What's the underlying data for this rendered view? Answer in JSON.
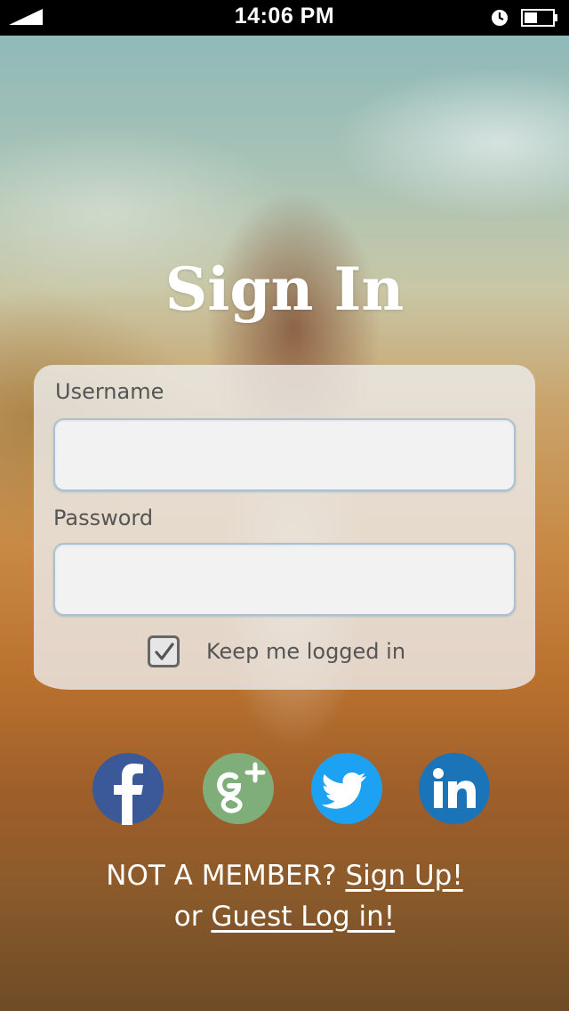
{
  "status_bar": {
    "time": "14:06 PM",
    "signal_icon": "signal-icon",
    "clock_icon": "clock-icon",
    "battery_icon": "battery-icon"
  },
  "title": "Sign In",
  "form": {
    "username_label": "Username",
    "username_value": "",
    "password_label": "Password",
    "password_value": "",
    "keep_logged_in_label": "Keep me logged in",
    "keep_logged_in_checked": true
  },
  "social": [
    {
      "name": "facebook",
      "icon": "facebook-icon",
      "color": "#3b5998"
    },
    {
      "name": "google-plus",
      "icon": "google-plus-icon",
      "color": "#7fae7a"
    },
    {
      "name": "twitter",
      "icon": "twitter-icon",
      "color": "#1da1f2"
    },
    {
      "name": "linkedin",
      "icon": "linkedin-icon",
      "color": "#1b74b8"
    }
  ],
  "footer": {
    "not_member_text": "NOT A MEMBER?",
    "signup_link": "Sign Up!",
    "or_text": "or",
    "guest_link": "Guest Log in!"
  }
}
